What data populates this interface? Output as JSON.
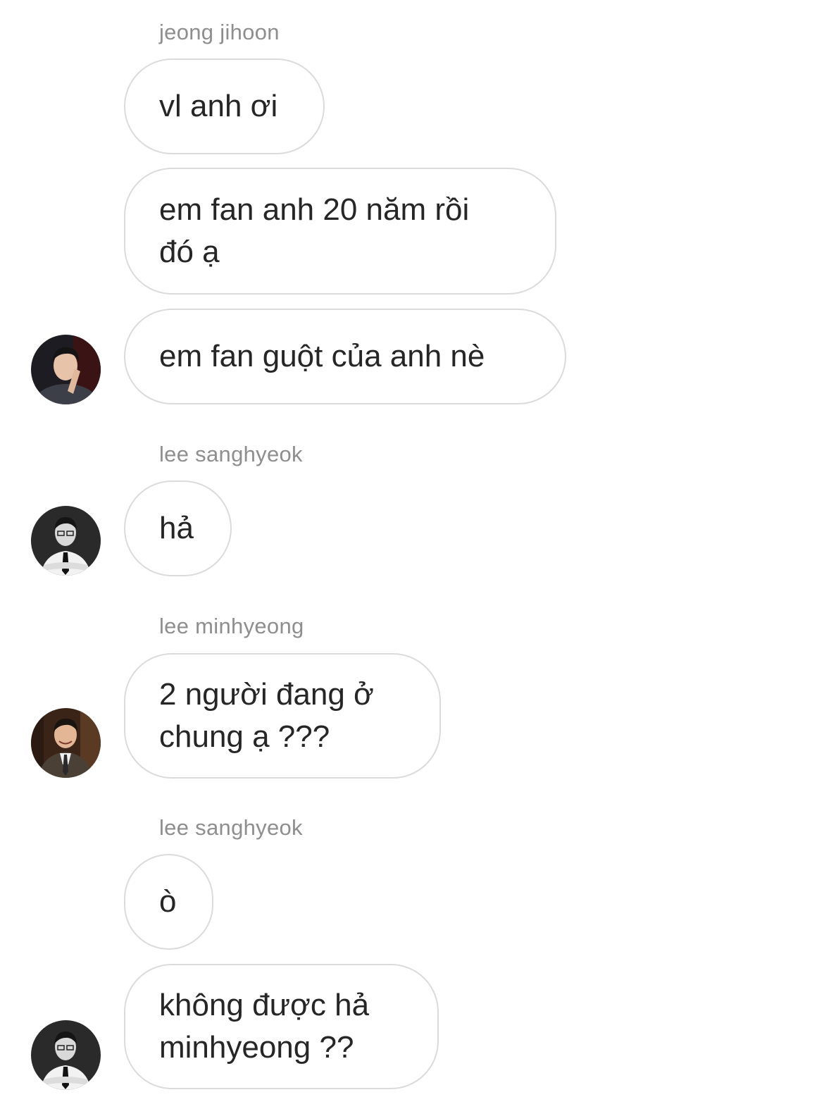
{
  "chat": {
    "senders": {
      "s1": "jeong jihoon",
      "s2": "lee sanghyeok",
      "s3": "lee minhyeong",
      "s4": "lee sanghyeok"
    },
    "messages": {
      "m1": "vl anh ơi",
      "m2": "em fan anh 20 năm rồi\nđó ạ",
      "m3": "em fan guột của anh nè",
      "m4": "hả",
      "m5": "2 người đang ở\nchung ạ ???",
      "m6": "ò",
      "m7": "không được hả\nminhyeong ??"
    }
  },
  "avatars": {
    "a1": "avatar-jeong-jihoon",
    "a2": "avatar-lee-sanghyeok",
    "a3": "avatar-lee-minhyeong",
    "a4": "avatar-lee-sanghyeok"
  },
  "colors": {
    "bubble_border": "#dbdbdb",
    "sender_name": "#8e8e8e",
    "message_text": "#262626",
    "background": "#ffffff"
  }
}
